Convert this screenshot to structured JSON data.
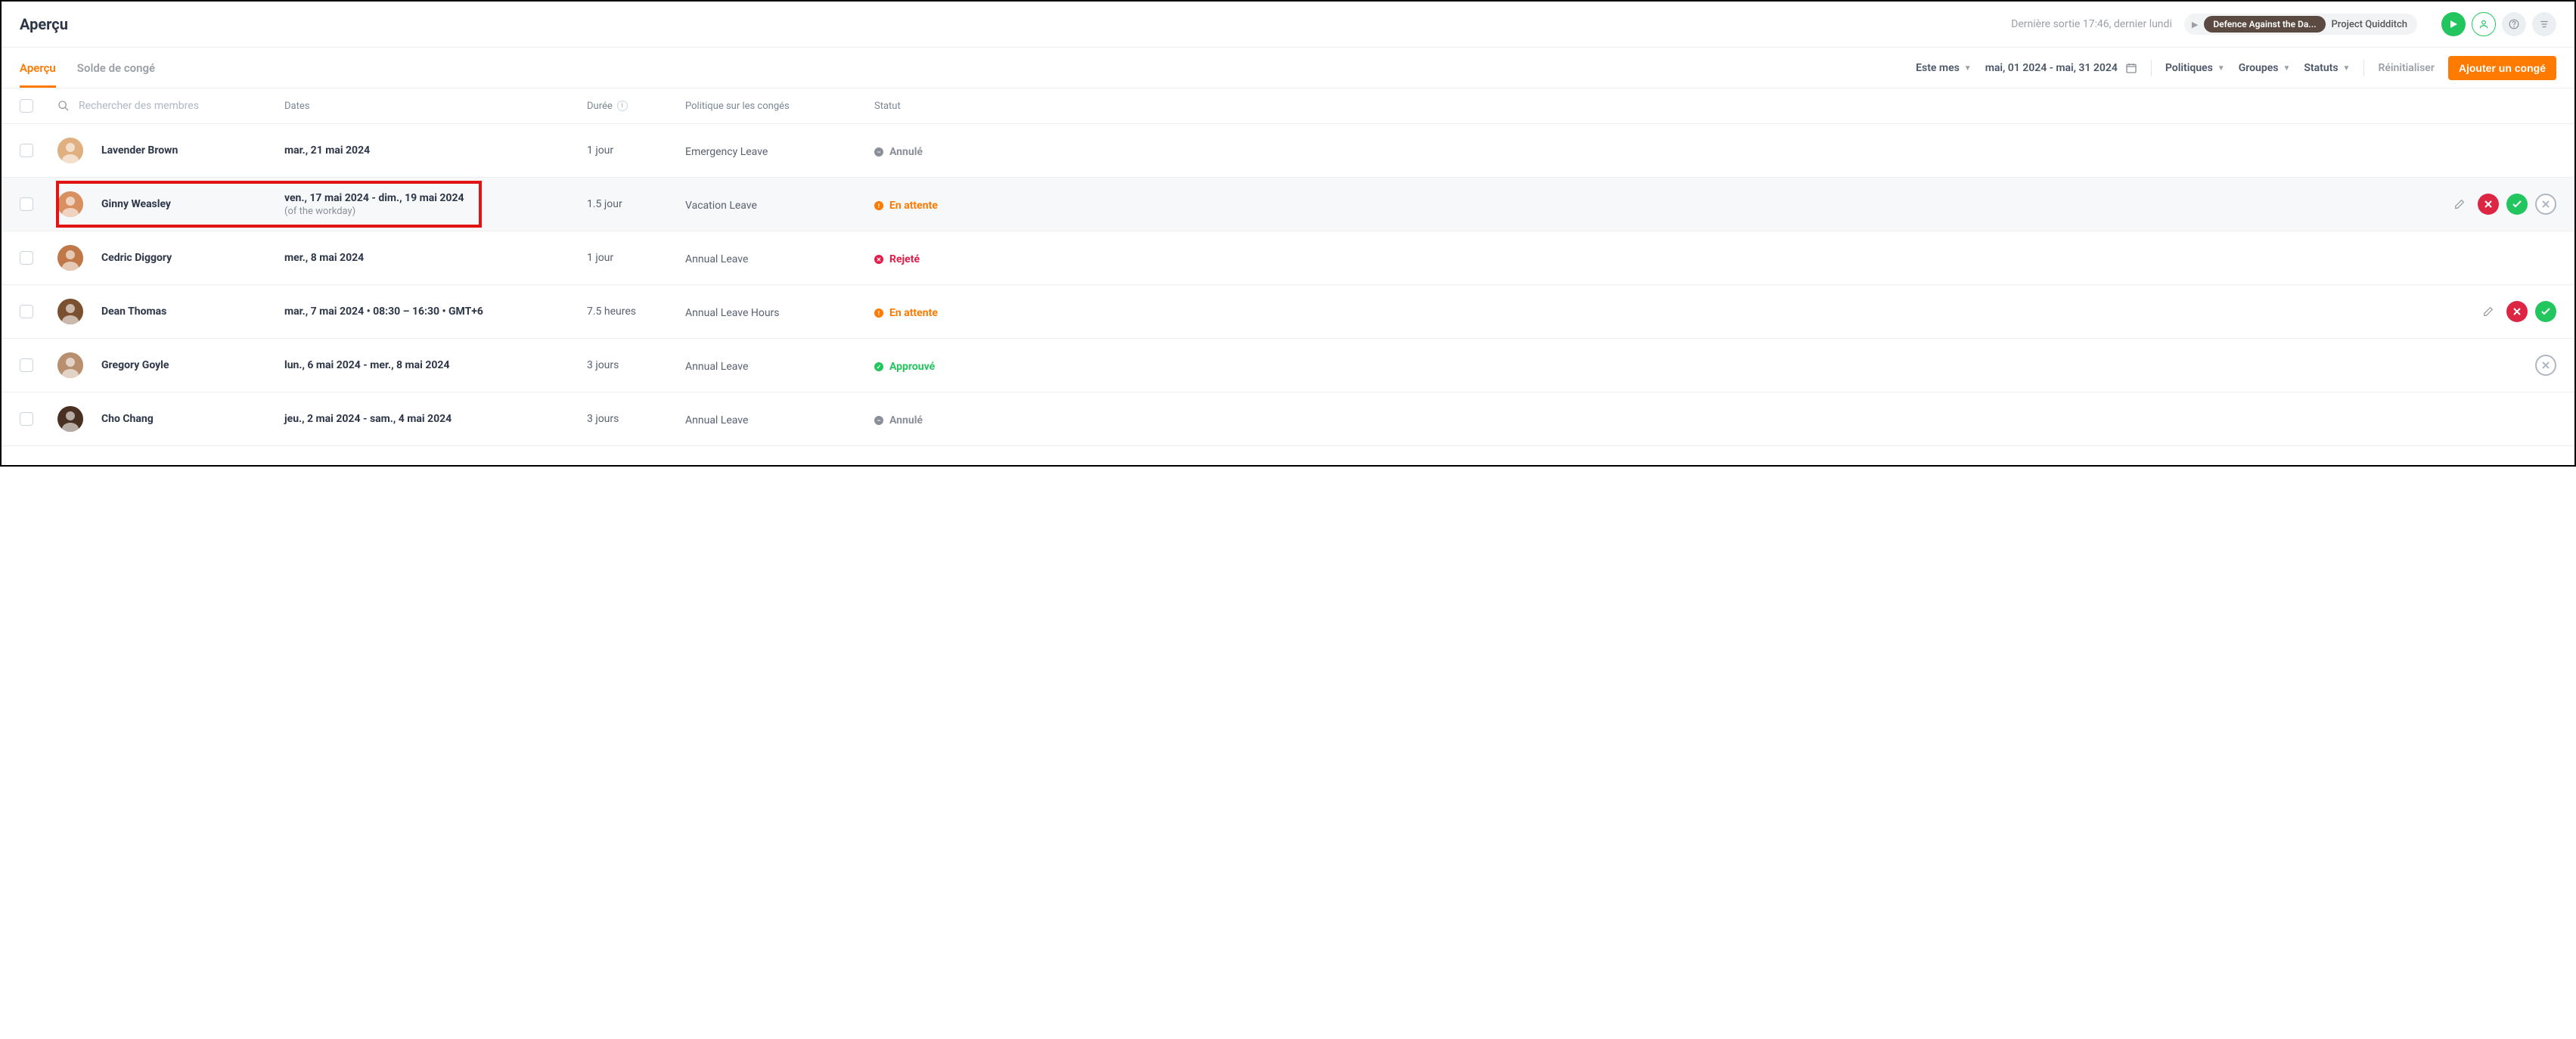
{
  "header": {
    "title": "Aperçu",
    "last_exit": "Dernière sortie 17:46, dernier lundi",
    "project_badge": "Defence Against the Da...",
    "project_secondary": "Project Quidditch"
  },
  "tabs": {
    "overview": "Aperçu",
    "balance": "Solde de congé"
  },
  "toolbar": {
    "period_label": "Este mes",
    "date_range": "mai, 01 2024 - mai, 31 2024",
    "policies": "Politiques",
    "groups": "Groupes",
    "statuses": "Statuts",
    "reset": "Réinitialiser",
    "add": "Ajouter un congé"
  },
  "columns": {
    "search_placeholder": "Rechercher des membres",
    "dates": "Dates",
    "duration": "Durée",
    "policy": "Politique sur les congés",
    "status": "Statut"
  },
  "status_labels": {
    "cancelled": "Annulé",
    "pending": "En attente",
    "rejected": "Rejeté",
    "approved": "Approuvé"
  },
  "rows": [
    {
      "name": "Lavender Brown",
      "date": "mar., 21 mai 2024",
      "date_sub": "",
      "duration": "1 jour",
      "policy": "Emergency Leave",
      "status": "cancelled",
      "actions": [],
      "hover": false,
      "highlight": false
    },
    {
      "name": "Ginny Weasley",
      "date": "ven., 17 mai 2024 - dim., 19 mai 2024",
      "date_sub": "(of the workday)",
      "duration": "1.5 jour",
      "policy": "Vacation Leave",
      "status": "pending",
      "actions": [
        "edit",
        "reject",
        "approve",
        "cancel"
      ],
      "hover": true,
      "highlight": true
    },
    {
      "name": "Cedric Diggory",
      "date": "mer., 8 mai 2024",
      "date_sub": "",
      "duration": "1 jour",
      "policy": "Annual Leave",
      "status": "rejected",
      "actions": [],
      "hover": false,
      "highlight": false
    },
    {
      "name": "Dean Thomas",
      "date": "mar., 7 mai 2024 • 08:30 – 16:30 • GMT+6",
      "date_sub": "",
      "duration": "7.5 heures",
      "policy": "Annual Leave Hours",
      "status": "pending",
      "actions": [
        "edit",
        "reject",
        "approve"
      ],
      "hover": false,
      "highlight": false
    },
    {
      "name": "Gregory Goyle",
      "date": "lun., 6 mai 2024 - mer., 8 mai 2024",
      "date_sub": "",
      "duration": "3 jours",
      "policy": "Annual Leave",
      "status": "approved",
      "actions": [
        "cancel"
      ],
      "hover": false,
      "highlight": false
    },
    {
      "name": "Cho Chang",
      "date": "jeu., 2 mai 2024 - sam., 4 mai 2024",
      "date_sub": "",
      "duration": "3 jours",
      "policy": "Annual Leave",
      "status": "cancelled",
      "actions": [],
      "hover": false,
      "highlight": false
    }
  ],
  "avatar_colors": [
    "#e0b080",
    "#d89060",
    "#c07848",
    "#7a5030",
    "#b89070",
    "#4a3022"
  ]
}
